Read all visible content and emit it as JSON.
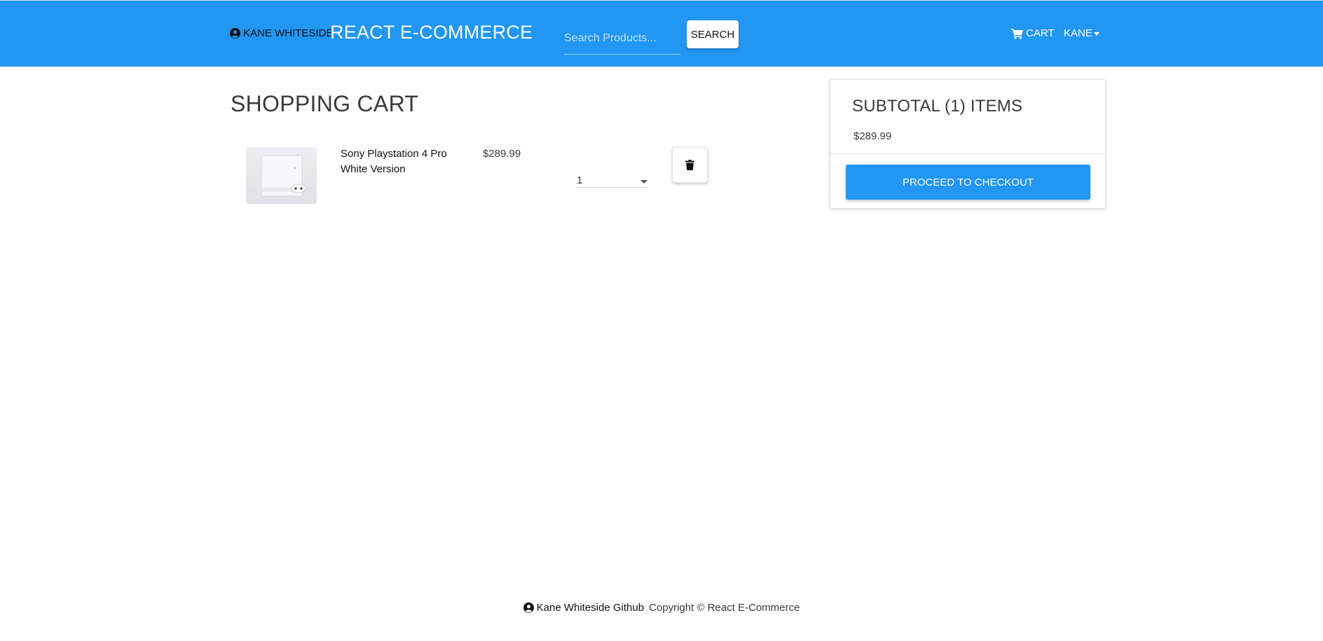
{
  "navbar": {
    "owner_label": "KANE WHITESIDE",
    "owner_icon": "user-circle-icon",
    "brand_title": "REACT E-COMMERCE",
    "search": {
      "placeholder": "Search Products...",
      "value": "",
      "button_label": "SEARCH"
    },
    "cart_label": "CART",
    "cart_icon": "shopping-cart-icon",
    "user_menu_label": "KANE"
  },
  "cart": {
    "title": "SHOPPING CART",
    "items": [
      {
        "name": "Sony Playstation 4 Pro White Version",
        "image_alt": "Sony Playstation 4 Pro White Version",
        "price": "$289.99",
        "quantity": "1",
        "delete_icon": "trash-icon"
      }
    ]
  },
  "summary": {
    "title": "SUBTOTAL (1) ITEMS",
    "amount": "$289.99",
    "checkout_label": "PROCEED TO CHECKOUT"
  },
  "footer": {
    "link_label": "Kane Whiteside Github",
    "copyright": "Copyright © React E-Commerce"
  },
  "colors": {
    "primary": "#2196f3",
    "text": "#3a3a3a",
    "white": "#ffffff"
  }
}
